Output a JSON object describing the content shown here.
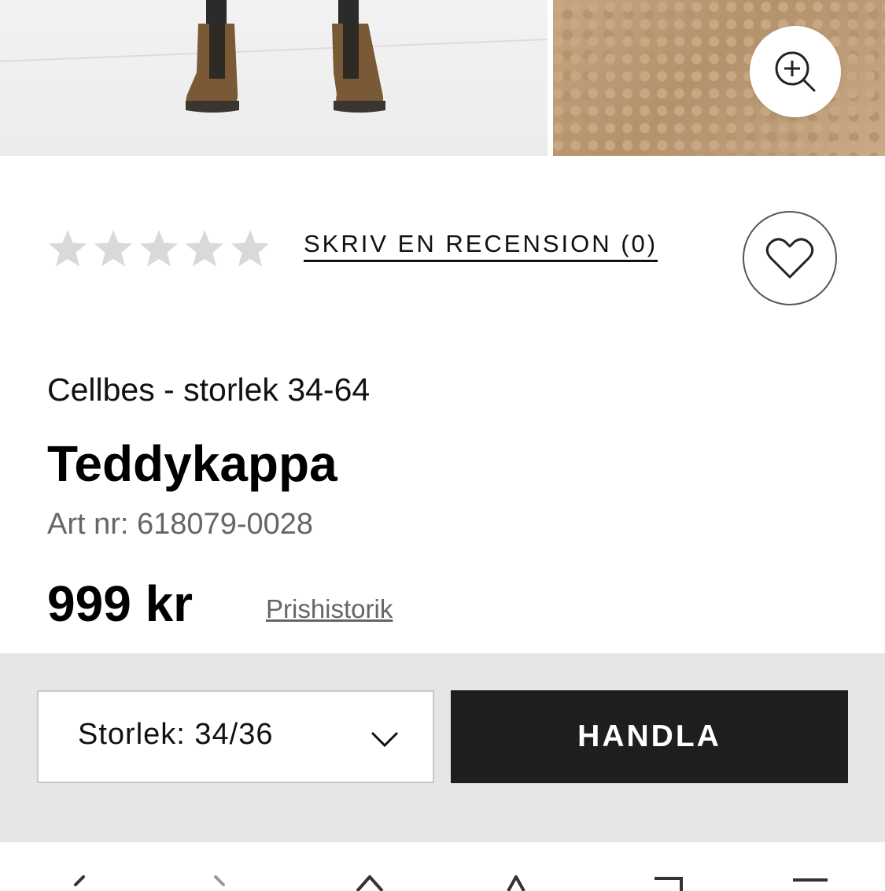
{
  "gallery": {
    "zoom_icon": "zoom-in-icon"
  },
  "rating": {
    "stars_filled": 0,
    "stars_total": 5,
    "star_color": "#d9d9d9",
    "review_link": "SKRIV EN RECENSION (0)",
    "favorite_icon": "heart-icon"
  },
  "product": {
    "brand": "Cellbes - storlek 34-64",
    "title": "Teddykappa",
    "art_nr": "Art nr: 618079-0028",
    "price": "999 kr",
    "price_history_link": "Prishistorik"
  },
  "purchase": {
    "size_select": "Storlek: 34/36",
    "buy_button": "HANDLA",
    "buy_button_color": "#1e1e1e",
    "bar_background": "#e6e6e6"
  },
  "browser_nav": {
    "icons": [
      "back-icon",
      "forward-icon",
      "home-icon",
      "share-icon",
      "tabs-icon",
      "menu-icon"
    ]
  }
}
